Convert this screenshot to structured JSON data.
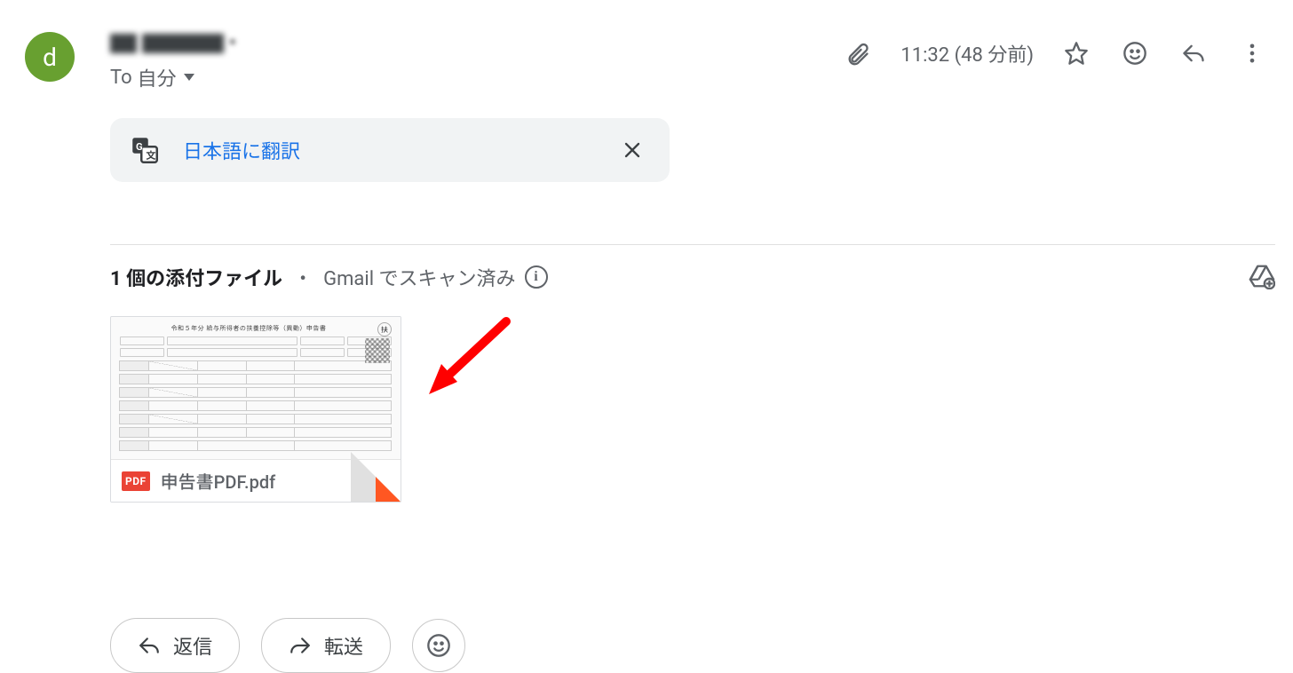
{
  "sender": {
    "avatar_initial": "d"
  },
  "to": {
    "prefix": "To",
    "recipient": "自分"
  },
  "meta": {
    "time": "11:32",
    "ago": "(48 分前)"
  },
  "translate": {
    "label": "日本語に翻訳"
  },
  "attachments": {
    "count_label": "1 個の添付ファイル",
    "scanned_label": "Gmail でスキャン済み",
    "items": [
      {
        "kind": "PDF",
        "filename": "申告書PDF.pdf",
        "preview_title": "令和５年分 給与所得者の扶養控除等（異動）申告書",
        "preview_badge": "扶"
      }
    ]
  },
  "actions": {
    "reply": "返信",
    "forward": "転送"
  }
}
